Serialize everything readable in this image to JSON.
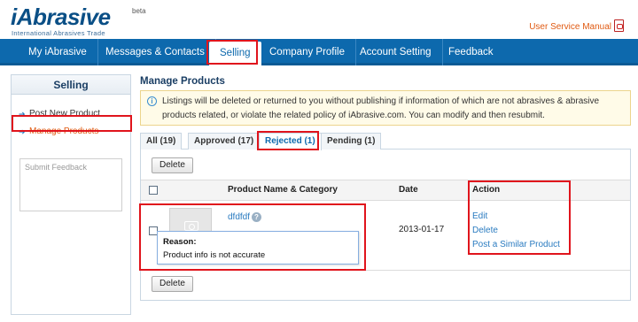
{
  "header": {
    "logo_text": "iAbrasive",
    "logo_badge": "beta",
    "logo_tagline": "International Abrasives Trade",
    "manual_link": "User Service Manual"
  },
  "nav": {
    "items": [
      {
        "label": "My iAbrasive"
      },
      {
        "label": "Messages & Contacts"
      },
      {
        "label": "Selling"
      },
      {
        "label": "Company Profile"
      },
      {
        "label": "Account Setting"
      },
      {
        "label": "Feedback"
      }
    ],
    "active": "Selling"
  },
  "sidebar": {
    "title": "Selling",
    "items": [
      {
        "label": "Post New Product"
      },
      {
        "label": "Manage Products"
      }
    ],
    "feedback_placeholder": "Submit Feedback"
  },
  "main": {
    "title": "Manage Products",
    "notice": "Listings will be deleted or returned to you without publishing if information of which are not abrasives & abrasive products related, or violate the related policy of iAbrasive.com. You can modify and then resubmit.",
    "tabs": [
      {
        "label": "All (19)"
      },
      {
        "label": "Approved (17)"
      },
      {
        "label": "Rejected (1)"
      },
      {
        "label": "Pending (1)"
      }
    ],
    "active_tab": "Rejected (1)",
    "delete_button": "Delete",
    "table": {
      "columns": [
        "Product Name & Category",
        "Date",
        "Action"
      ],
      "rows": [
        {
          "name": "dfdfdf",
          "date": "2013-01-17",
          "actions": [
            "Edit",
            "Delete",
            "Post a Similar Product"
          ],
          "reason_label": "Reason:",
          "reason_text": "Product info is not accurate"
        }
      ]
    }
  },
  "colors": {
    "nav_bg": "#0d69ad",
    "link": "#2a7bc0",
    "accent_orange": "#e05a12",
    "highlight_red": "#e0141c"
  }
}
